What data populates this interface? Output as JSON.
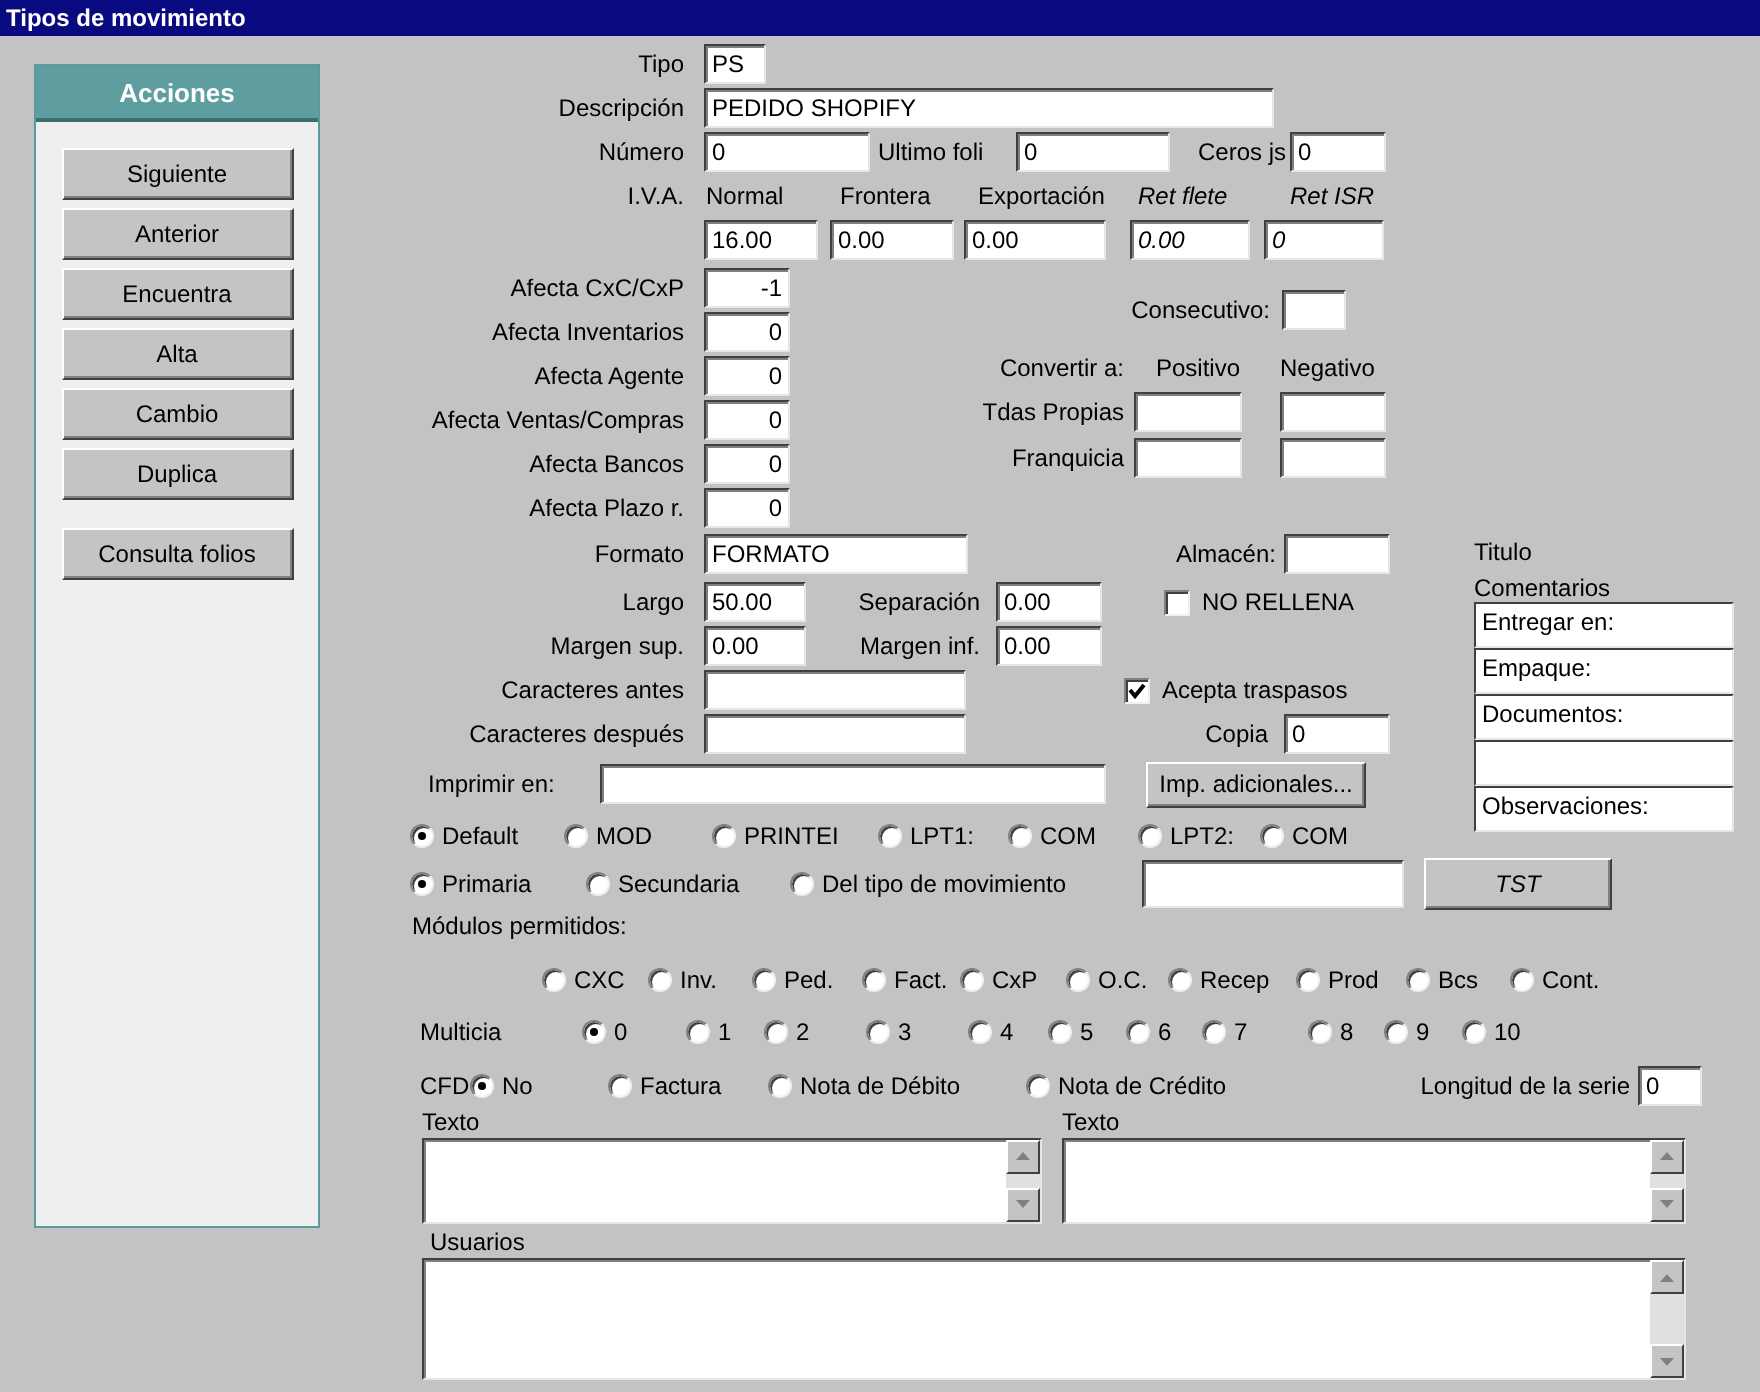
{
  "window": {
    "title": "Tipos de movimiento"
  },
  "actions": {
    "title": "Acciones",
    "buttons": [
      "Siguiente",
      "Anterior",
      "Encuentra",
      "Alta",
      "Cambio",
      "Duplica"
    ],
    "extra_button": "Consulta folios"
  },
  "tipo": {
    "label": "Tipo",
    "value": "PS"
  },
  "descripcion": {
    "label": "Descripción",
    "value": "PEDIDO SHOPIFY"
  },
  "numero": {
    "label": "Número",
    "value": "0"
  },
  "ultimo_folio": {
    "label": "Ultimo foli",
    "value": "0"
  },
  "ceros": {
    "label": "Ceros js",
    "value": "0"
  },
  "iva": {
    "label": "I.V.A.",
    "columns": [
      {
        "label": "Normal",
        "value": "16.00",
        "kind": "rate"
      },
      {
        "label": "Frontera",
        "value": "0.00",
        "kind": "rate"
      },
      {
        "label": "Exportación",
        "value": "0.00",
        "kind": "rate"
      },
      {
        "label": "Ret flete",
        "value": "0.00",
        "kind": "retention"
      },
      {
        "label": "Ret ISR",
        "value": "0",
        "kind": "retention"
      }
    ]
  },
  "afecta": [
    {
      "label": "Afecta  CxC/CxP",
      "value": "-1"
    },
    {
      "label": "Afecta  Inventarios",
      "value": "0"
    },
    {
      "label": "Afecta  Agente",
      "value": "0"
    },
    {
      "label": "Afecta  Ventas/Compras",
      "value": "0"
    },
    {
      "label": "Afecta  Bancos",
      "value": "0"
    },
    {
      "label": "Afecta  Plazo r.",
      "value": "0"
    }
  ],
  "consecutivo": {
    "label": "Consecutivo:"
  },
  "convertir": {
    "label": "Convertir a:",
    "columns": [
      "Positivo",
      "Negativo"
    ],
    "rows": [
      "Tdas Propias",
      "Franquicia"
    ]
  },
  "formato": {
    "label": "Formato",
    "value": "FORMATO"
  },
  "almacen": {
    "label": "Almacén:"
  },
  "largo": {
    "label": "Largo",
    "value": "50.00"
  },
  "separacion": {
    "label": "Separación",
    "value": "0.00"
  },
  "no_rellena": {
    "label": "NO RELLENA",
    "checked": false
  },
  "margen_sup": {
    "label": "Margen sup.",
    "value": "0.00"
  },
  "margen_inf": {
    "label": "Margen inf.",
    "value": "0.00"
  },
  "caracteres_antes": {
    "label": "Caracteres antes"
  },
  "caracteres_despues": {
    "label": "Caracteres después"
  },
  "acepta_traspasos": {
    "label": "Acepta traspasos",
    "checked": true
  },
  "copia": {
    "label": "Copia",
    "value": "0"
  },
  "imprimir_en": {
    "label": "Imprimir en:"
  },
  "imp_adicionales_button": "Imp. adicionales...",
  "comentarios": {
    "title_label": "Titulo",
    "label": "Comentarios",
    "rows": [
      {
        "value": "Entregar en:"
      },
      {
        "value": "Empaque:"
      },
      {
        "value": "Documentos:"
      },
      {},
      {
        "value": "Observaciones:"
      }
    ]
  },
  "printer_options": [
    {
      "label": "Default",
      "selected": true
    },
    {
      "label": "MOD",
      "selected": false
    },
    {
      "label": "PRINTEI",
      "selected": false
    },
    {
      "label": "LPT1:",
      "selected": false
    },
    {
      "label": "COM",
      "selected": false
    },
    {
      "label": "LPT2:",
      "selected": false
    },
    {
      "label": "COM",
      "selected": false
    }
  ],
  "source_options": [
    {
      "label": "Primaria",
      "selected": true
    },
    {
      "label": "Secundaria",
      "selected": false
    },
    {
      "label": "Del tipo de movimiento",
      "selected": false
    }
  ],
  "tst_button": "TST",
  "modulos": {
    "label": "Módulos permitidos:",
    "options": [
      {
        "label": "CXC",
        "selected": false
      },
      {
        "label": "Inv.",
        "selected": false
      },
      {
        "label": "Ped.",
        "selected": false
      },
      {
        "label": "Fact.",
        "selected": false
      },
      {
        "label": "CxP",
        "selected": false
      },
      {
        "label": "O.C.",
        "selected": false
      },
      {
        "label": "Recep",
        "selected": false
      },
      {
        "label": "Prod",
        "selected": false
      },
      {
        "label": "Bcs",
        "selected": false
      },
      {
        "label": "Cont.",
        "selected": false
      }
    ]
  },
  "multicia": {
    "label": "Multicia",
    "options": [
      {
        "label": "0",
        "selected": true
      },
      {
        "label": "1",
        "selected": false
      },
      {
        "label": "2",
        "selected": false
      },
      {
        "label": "3",
        "selected": false
      },
      {
        "label": "4",
        "selected": false
      },
      {
        "label": "5",
        "selected": false
      },
      {
        "label": "6",
        "selected": false
      },
      {
        "label": "7",
        "selected": false
      },
      {
        "label": "8",
        "selected": false
      },
      {
        "label": "9",
        "selected": false
      },
      {
        "label": "10",
        "selected": false
      }
    ]
  },
  "cfd": {
    "label": "CFD",
    "options": [
      {
        "label": "No",
        "selected": true
      },
      {
        "label": "Factura",
        "selected": false
      },
      {
        "label": "Nota de Débito",
        "selected": false
      },
      {
        "label": "Nota de Crédito",
        "selected": false
      }
    ]
  },
  "longitud_serie": {
    "label": "Longitud de la serie",
    "value": "0"
  },
  "textos": [
    {
      "label": "Texto"
    },
    {
      "label": "Texto"
    }
  ],
  "usuarios": {
    "label": "Usuarios"
  }
}
